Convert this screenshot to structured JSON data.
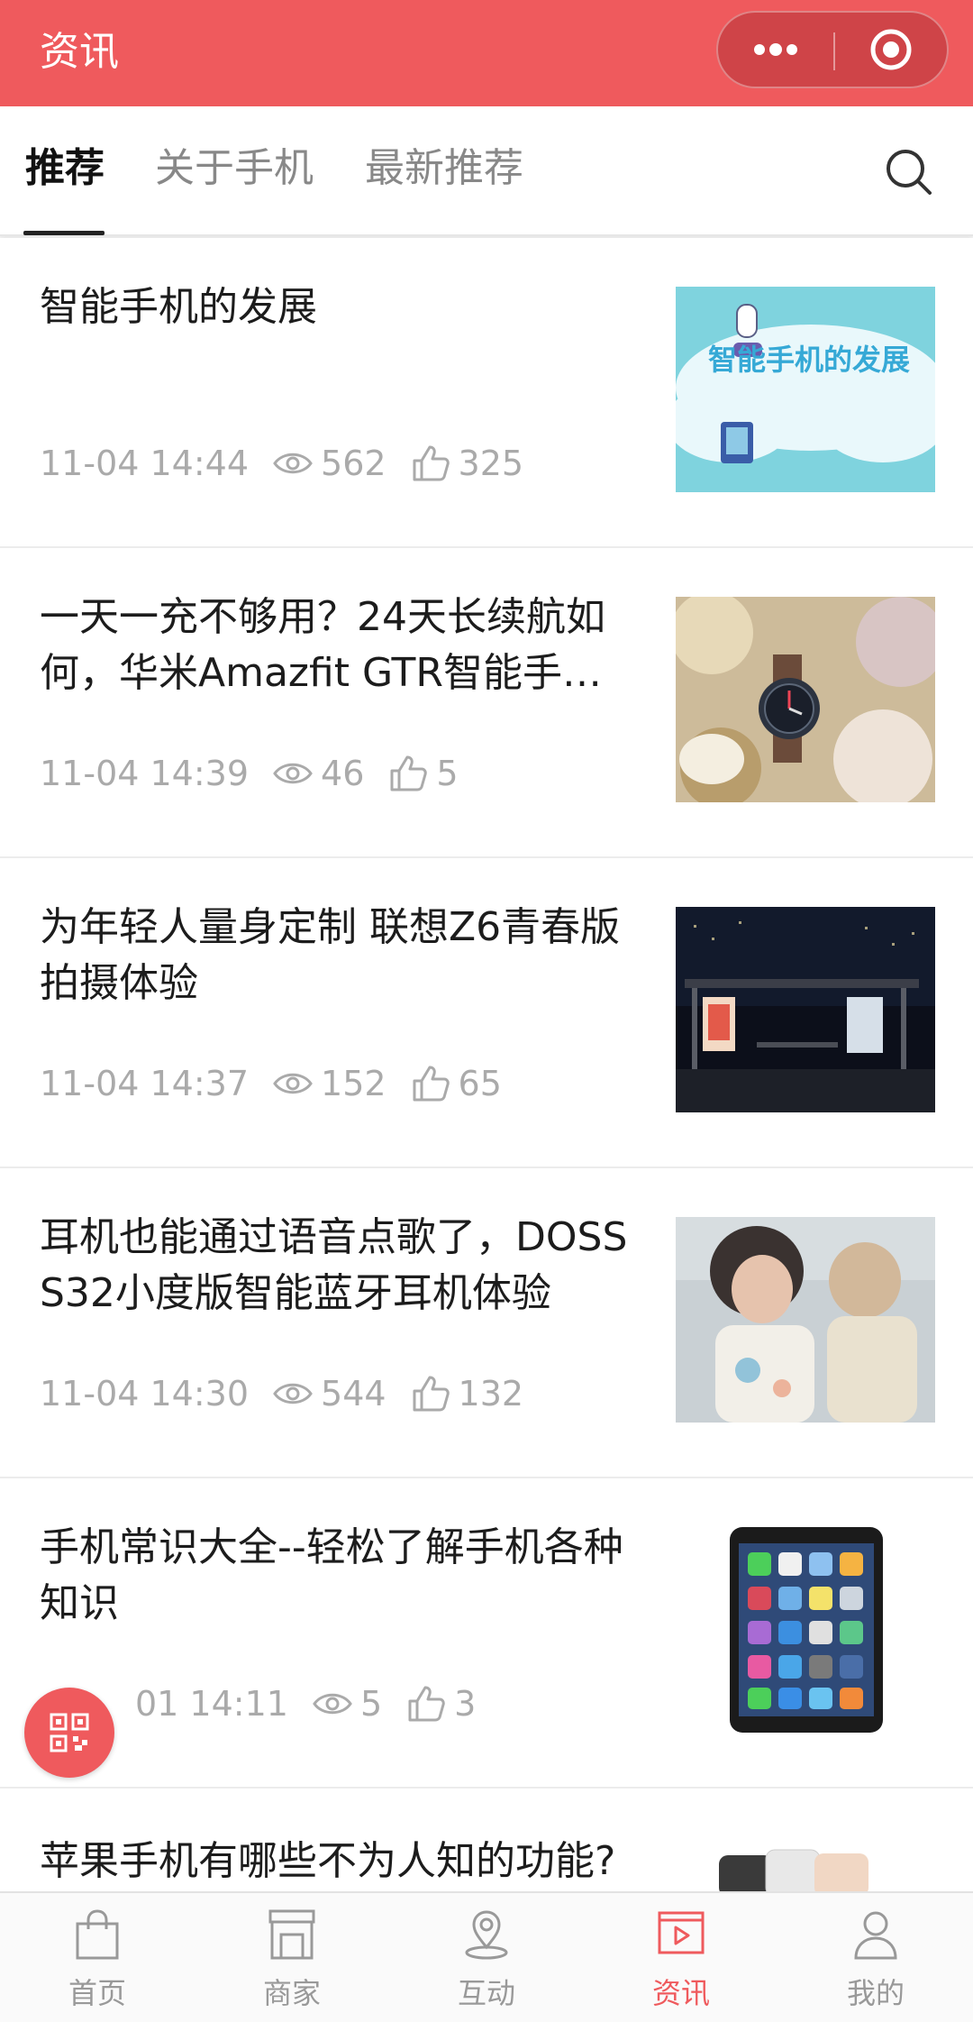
{
  "header": {
    "title": "资讯"
  },
  "tabs": [
    {
      "label": "推荐"
    },
    {
      "label": "关于手机"
    },
    {
      "label": "最新推荐"
    }
  ],
  "articles": [
    {
      "title": "智能手机的发展",
      "date": "11-04 14:44",
      "views": "562",
      "likes": "325",
      "thumb_text": "智能手机的发展"
    },
    {
      "title": "一天一充不够用？24天长续航如何，华米Amazfit GTR智能手表…",
      "date": "11-04 14:39",
      "views": "46",
      "likes": "5"
    },
    {
      "title": "为年轻人量身定制 联想Z6青春版拍摄体验",
      "date": "11-04 14:37",
      "views": "152",
      "likes": "65"
    },
    {
      "title": "耳机也能通过语音点歌了，DOSS S32小度版智能蓝牙耳机体验",
      "date": "11-04 14:30",
      "views": "544",
      "likes": "132"
    },
    {
      "title": "手机常识大全--轻松了解手机各种知识",
      "date": "01 14:11",
      "views": "5",
      "likes": "3"
    },
    {
      "title": "苹果手机有哪些不为人知的功能?"
    }
  ],
  "bottom_nav": [
    {
      "label": "首页",
      "icon": "bag-icon"
    },
    {
      "label": "商家",
      "icon": "store-icon"
    },
    {
      "label": "互动",
      "icon": "map-pin-icon"
    },
    {
      "label": "资讯",
      "icon": "video-play-icon",
      "active": true
    },
    {
      "label": "我的",
      "icon": "user-icon"
    }
  ],
  "colors": {
    "brand": "#ef5a5d",
    "active_tab": "#111111",
    "meta": "#aaaaaa"
  }
}
